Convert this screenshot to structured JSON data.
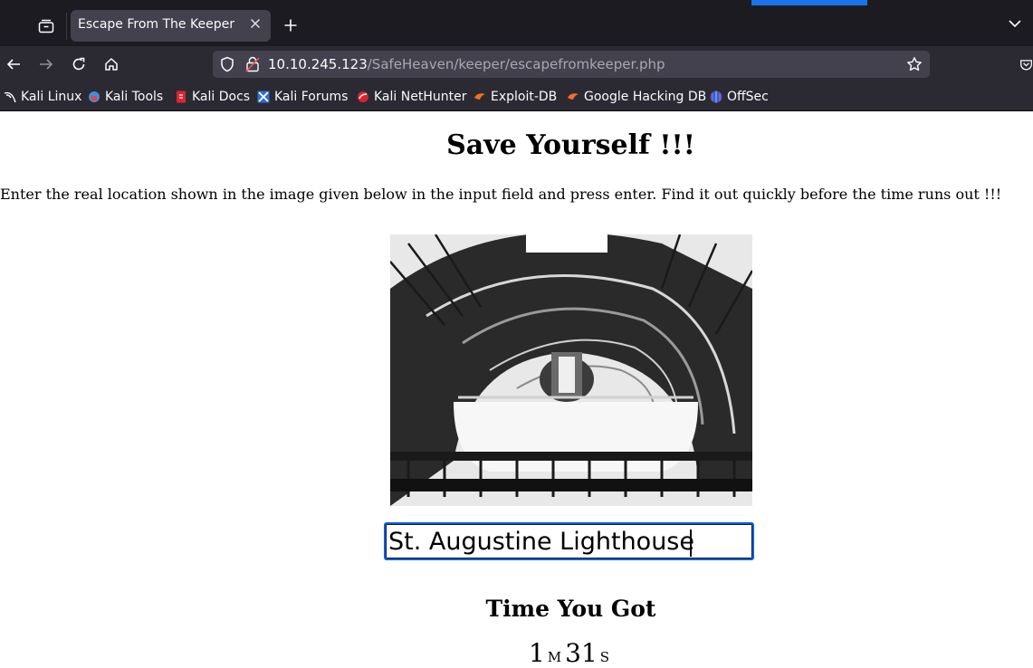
{
  "browser": {
    "tab": {
      "title": "Escape From The Keeper"
    },
    "url": {
      "host": "10.10.245.123",
      "path": "/SafeHeaven/keeper/escapefromkeeper.php"
    },
    "bookmarks": [
      {
        "label": "Kali Linux",
        "icon": "kali-dragon-icon"
      },
      {
        "label": "Kali Tools",
        "icon": "kali-tools-icon"
      },
      {
        "label": "Kali Docs",
        "icon": "kali-docs-icon"
      },
      {
        "label": "Kali Forums",
        "icon": "kali-forums-icon"
      },
      {
        "label": "Kali NetHunter",
        "icon": "kali-nethunter-icon"
      },
      {
        "label": "Exploit-DB",
        "icon": "exploit-db-icon"
      },
      {
        "label": "Google Hacking DB",
        "icon": "google-hacking-db-icon"
      },
      {
        "label": "OffSec",
        "icon": "offsec-icon"
      }
    ],
    "colors": {
      "accent": "#0060df",
      "chrome_dark": "#1c1b22",
      "chrome": "#2b2a33",
      "field": "#42414d"
    }
  },
  "page": {
    "heading": "Save Yourself !!!",
    "instructions": "Enter the real location shown in the image given below in the input field and press enter. Find it out quickly before the time runs out !!!",
    "image": {
      "alt": "Spiral staircase inside a lighthouse viewed from below"
    },
    "answer_input": {
      "value": "St. Augustine Lighthouse"
    },
    "timer": {
      "heading": "Time You Got",
      "minutes": "1",
      "minutes_unit": "M",
      "seconds": "31",
      "seconds_unit": "S"
    }
  }
}
